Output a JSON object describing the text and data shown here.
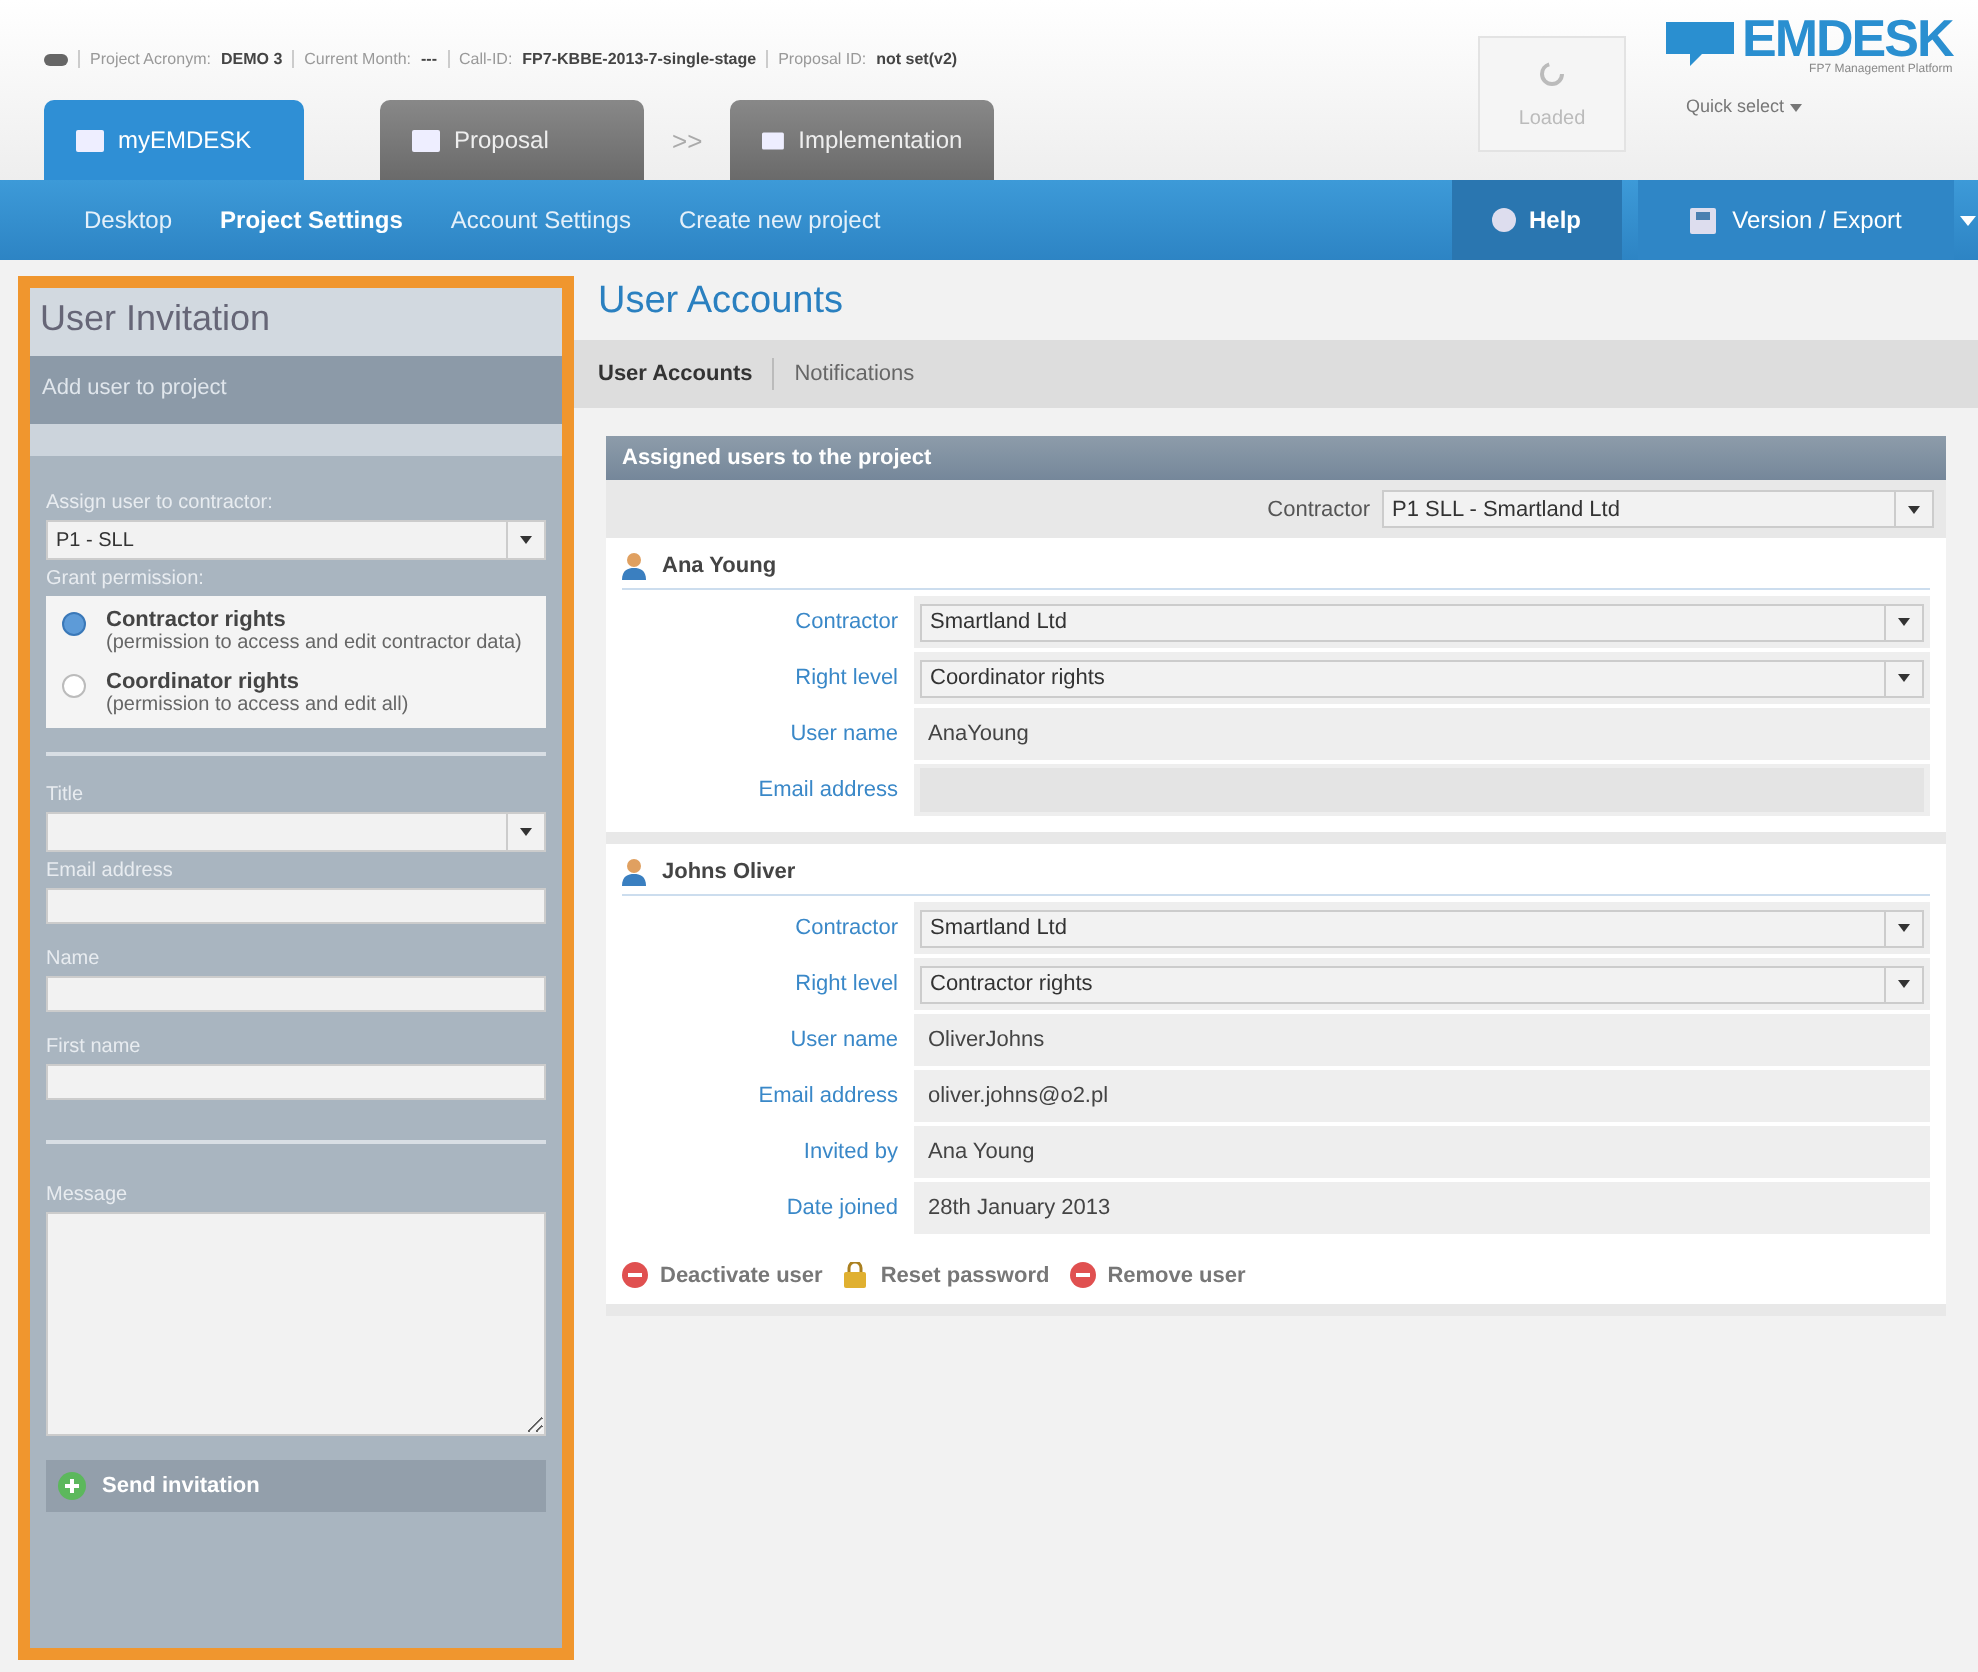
{
  "header": {
    "info": [
      {
        "label": "Project Acronym:",
        "value": "DEMO 3"
      },
      {
        "label": "Current Month:",
        "value": "---"
      },
      {
        "label": "Call-ID:",
        "value": "FP7-KBBE-2013-7-single-stage"
      },
      {
        "label": "Proposal ID:",
        "value": "not set(v2)"
      }
    ],
    "tabs": [
      {
        "label": "myEMDESK",
        "selected": true
      },
      {
        "label": "Proposal",
        "selected": false
      },
      {
        "label": "Implementation",
        "selected": false
      }
    ],
    "separator": ">>",
    "loaded": "Loaded",
    "logo": "EMDESK",
    "logo_sub": "FP7 Management Platform",
    "quick_select": "Quick select"
  },
  "nav": {
    "items": [
      {
        "label": "Desktop",
        "selected": false
      },
      {
        "label": "Project Settings",
        "selected": true
      },
      {
        "label": "Account Settings",
        "selected": false
      },
      {
        "label": "Create new project",
        "selected": false
      }
    ],
    "help": "Help",
    "version": "Version / Export"
  },
  "invitation": {
    "title": "User Invitation",
    "subtitle": "Add user to project",
    "contractor_label": "Assign user to contractor:",
    "contractor_value": "P1 - SLL",
    "permission_label": "Grant permission:",
    "permissions": [
      {
        "title": "Contractor rights",
        "desc": "(permission to access and edit contractor data)",
        "selected": true
      },
      {
        "title": "Coordinator rights",
        "desc": "(permission to access and edit all)",
        "selected": false
      }
    ],
    "fields": [
      {
        "label": "Title",
        "kind": "select"
      },
      {
        "label": "Email address",
        "kind": "text"
      },
      {
        "label": "Name",
        "kind": "text"
      },
      {
        "label": "First name",
        "kind": "text"
      }
    ],
    "message_label": "Message",
    "send": "Send invitation"
  },
  "accounts": {
    "title": "User Accounts",
    "tabs": [
      {
        "label": "User Accounts",
        "selected": true
      },
      {
        "label": "Notifications",
        "selected": false
      }
    ],
    "panel_title": "Assigned users to the project",
    "filter_label": "Contractor",
    "filter_value": "P1 SLL - Smartland Ltd",
    "users": [
      {
        "name": "Ana Young",
        "fields": [
          {
            "label": "Contractor",
            "value": "Smartland Ltd",
            "kind": "select"
          },
          {
            "label": "Right level",
            "value": "Coordinator rights",
            "kind": "select"
          },
          {
            "label": "User name",
            "value": "AnaYoung",
            "kind": "static"
          },
          {
            "label": "Email address",
            "kind": "input"
          }
        ]
      },
      {
        "name": "Johns Oliver",
        "fields": [
          {
            "label": "Contractor",
            "value": "Smartland Ltd",
            "kind": "select"
          },
          {
            "label": "Right level",
            "value": "Contractor rights",
            "kind": "select"
          },
          {
            "label": "User name",
            "value": "OliverJohns",
            "kind": "static"
          },
          {
            "label": "Email address",
            "value": "oliver.johns@o2.pl",
            "kind": "static"
          },
          {
            "label": "Invited by",
            "value": "Ana Young",
            "kind": "static"
          },
          {
            "label": "Date joined",
            "value": "28th January 2013",
            "kind": "static"
          }
        ],
        "actions": [
          {
            "label": "Deactivate user",
            "kind": "remove"
          },
          {
            "label": "Reset password",
            "kind": "key"
          },
          {
            "label": "Remove user",
            "kind": "remove"
          }
        ]
      }
    ]
  }
}
